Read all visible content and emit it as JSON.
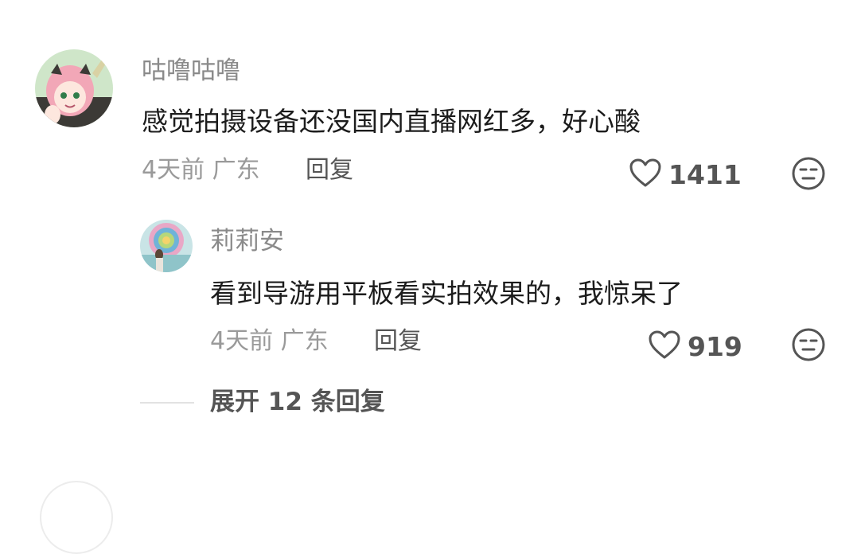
{
  "comment": {
    "username": "咕噜咕噜",
    "text": "感觉拍摄设备还没国内直播网红多，好心酸",
    "time_location": "4天前 广东",
    "reply_label": "回复",
    "likes": "1411"
  },
  "reply": {
    "username": "莉莉安",
    "text": "看到导游用平板看实拍效果的，我惊呆了",
    "time_location": "4天前 广东",
    "reply_label": "回复",
    "likes": "919"
  },
  "expand": {
    "label": "展开 12 条回复"
  },
  "icons": {
    "like": "heart-outline-icon",
    "dislike": "unamused-face-icon"
  },
  "colors": {
    "username": "#8a8a8a",
    "text": "#1c1c1c",
    "meta": "#9a9a9a",
    "action": "#555555"
  }
}
